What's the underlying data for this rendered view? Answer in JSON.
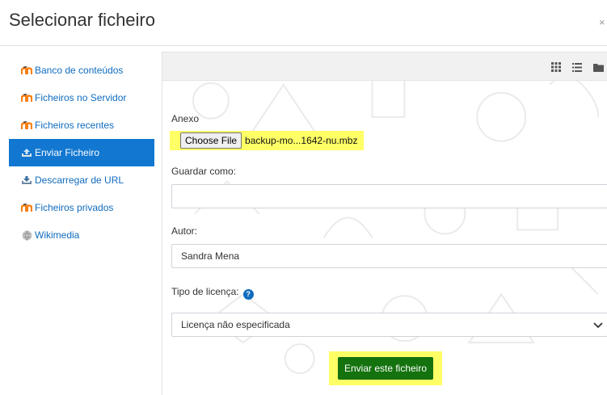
{
  "dialog": {
    "title": "Selecionar ficheiro",
    "close_label": "×"
  },
  "sidebar": {
    "items": [
      {
        "label": "Banco de conteúdos",
        "icon": "moodle-icon"
      },
      {
        "label": "Ficheiros no Servidor",
        "icon": "moodle-icon"
      },
      {
        "label": "Ficheiros recentes",
        "icon": "moodle-icon"
      },
      {
        "label": "Enviar Ficheiro",
        "icon": "upload-icon",
        "active": true
      },
      {
        "label": "Descarregar de URL",
        "icon": "download-url-icon"
      },
      {
        "label": "Ficheiros privados",
        "icon": "moodle-icon"
      },
      {
        "label": "Wikimedia",
        "icon": "wikimedia-icon"
      }
    ]
  },
  "toolbar": {
    "views": [
      "icons-view-icon",
      "list-view-icon",
      "folder-view-icon"
    ]
  },
  "form": {
    "attachment_label": "Anexo",
    "choose_file_label": "Choose File",
    "file_name": "backup-mo...1642-nu.mbz",
    "save_as_label": "Guardar como:",
    "save_as_value": "",
    "author_label": "Autor:",
    "author_value": "Sandra Mena",
    "license_label": "Tipo de licença:",
    "license_value": "Licença não especificada",
    "submit_label": "Enviar este ficheiro"
  },
  "colors": {
    "active_item": "#1177d1",
    "submit": "#14720f",
    "highlight": "#ffff66",
    "link": "#0f6cbf"
  }
}
